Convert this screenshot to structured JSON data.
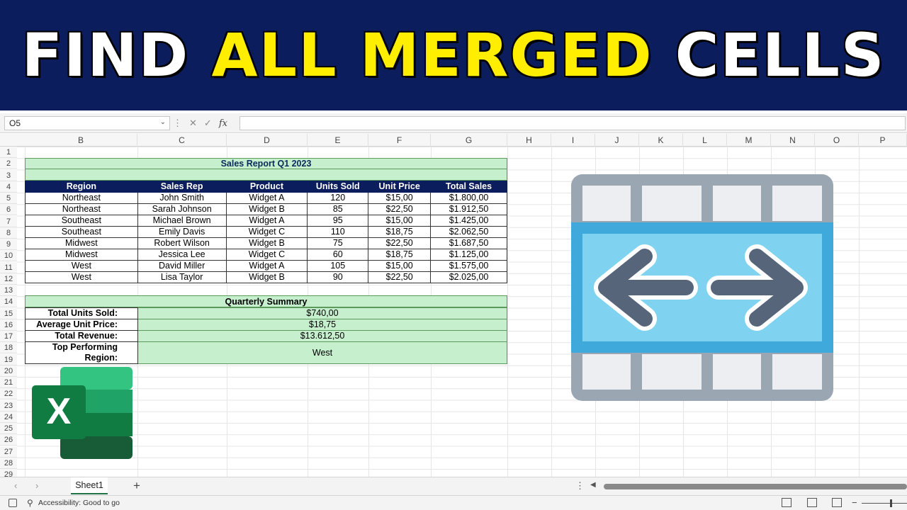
{
  "banner": {
    "word1": "FIND",
    "word2": "ALL MERGED",
    "word3": "CELLS"
  },
  "formula_bar": {
    "name_box": "O5",
    "fx": "fx"
  },
  "columns": [
    "B",
    "C",
    "D",
    "E",
    "F",
    "G",
    "H",
    "I",
    "J",
    "K",
    "L",
    "M",
    "N",
    "O",
    "P"
  ],
  "rows": [
    "1",
    "2",
    "3",
    "4",
    "5",
    "6",
    "7",
    "8",
    "9",
    "10",
    "11",
    "12",
    "13",
    "14",
    "15",
    "16",
    "17",
    "18",
    "19",
    "20",
    "21",
    "22",
    "23",
    "24",
    "25",
    "26",
    "27",
    "28",
    "29"
  ],
  "report": {
    "title": "Sales Report Q1 2023",
    "headers": [
      "Region",
      "Sales Rep",
      "Product",
      "Units Sold",
      "Unit Price",
      "Total Sales"
    ],
    "rows": [
      [
        "Northeast",
        "John Smith",
        "Widget A",
        "120",
        "$15,00",
        "$1.800,00"
      ],
      [
        "Northeast",
        "Sarah Johnson",
        "Widget B",
        "85",
        "$22,50",
        "$1.912,50"
      ],
      [
        "Southeast",
        "Michael Brown",
        "Widget A",
        "95",
        "$15,00",
        "$1.425,00"
      ],
      [
        "Southeast",
        "Emily Davis",
        "Widget C",
        "110",
        "$18,75",
        "$2.062,50"
      ],
      [
        "Midwest",
        "Robert Wilson",
        "Widget B",
        "75",
        "$22,50",
        "$1.687,50"
      ],
      [
        "Midwest",
        "Jessica Lee",
        "Widget C",
        "60",
        "$18,75",
        "$1.125,00"
      ],
      [
        "West",
        "David Miller",
        "Widget A",
        "105",
        "$15,00",
        "$1.575,00"
      ],
      [
        "West",
        "Lisa Taylor",
        "Widget B",
        "90",
        "$22,50",
        "$2.025,00"
      ]
    ]
  },
  "summary": {
    "title": "Quarterly Summary",
    "items": [
      {
        "label": "Total Units Sold:",
        "value": "$740,00"
      },
      {
        "label": "Average Unit Price:",
        "value": "$18,75"
      },
      {
        "label": "Total Revenue:",
        "value": "$13.612,50"
      },
      {
        "label": "Top Performing Region:",
        "value": "West"
      }
    ]
  },
  "logo": {
    "letter": "X"
  },
  "sheet_tabs": {
    "active": "Sheet1",
    "add": "+"
  },
  "status": {
    "accessibility": "Accessibility: Good to go"
  },
  "colors": {
    "banner_bg": "#0b1d5c",
    "highlight": "#ffee00",
    "merged_fill": "#c6efce",
    "header_fill": "#0b1d5c",
    "excel_green": "#217346",
    "icon_blue": "#4fb3e0"
  }
}
